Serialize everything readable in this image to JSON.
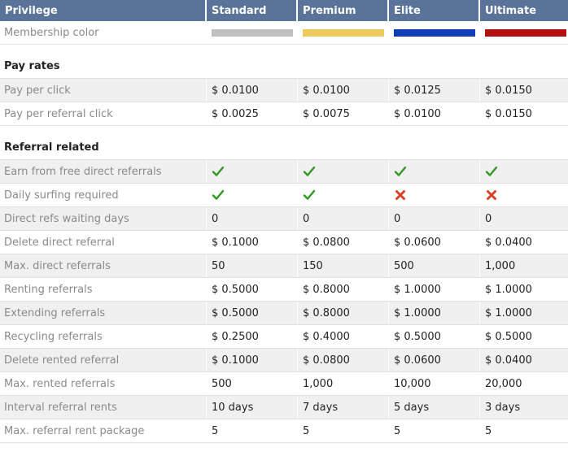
{
  "header": {
    "privilege": "Privilege",
    "plans": [
      "Standard",
      "Premium",
      "Elite",
      "Ultimate"
    ]
  },
  "membership": {
    "label": "Membership color",
    "colors": [
      "#c0c0c0",
      "#eccb5c",
      "#0f3fb5",
      "#b40f0f"
    ]
  },
  "sections": {
    "pay_rates": "Pay rates",
    "referral_related": "Referral related"
  },
  "pay_rates": [
    {
      "label": "Pay per click",
      "values": [
        "$ 0.0100",
        "$ 0.0100",
        "$ 0.0125",
        "$ 0.0150"
      ]
    },
    {
      "label": "Pay per referral click",
      "values": [
        "$ 0.0025",
        "$ 0.0075",
        "$ 0.0100",
        "$ 0.0150"
      ]
    }
  ],
  "referral": [
    {
      "label": "Earn from free direct referrals",
      "icons": [
        "check-icon",
        "check-icon",
        "check-icon",
        "check-icon"
      ]
    },
    {
      "label": "Daily surfing required",
      "icons": [
        "check-icon",
        "check-icon",
        "cross-icon",
        "cross-icon"
      ]
    },
    {
      "label": "Direct refs waiting days",
      "values": [
        "0",
        "0",
        "0",
        "0"
      ]
    },
    {
      "label": "Delete direct referral",
      "values": [
        "$ 0.1000",
        "$ 0.0800",
        "$ 0.0600",
        "$ 0.0400"
      ]
    },
    {
      "label": "Max. direct referrals",
      "values": [
        "50",
        "150",
        "500",
        "1,000"
      ]
    },
    {
      "label": "Renting referrals",
      "values": [
        "$ 0.5000",
        "$ 0.8000",
        "$ 1.0000",
        "$ 1.0000"
      ]
    },
    {
      "label": "Extending referrals",
      "values": [
        "$ 0.5000",
        "$ 0.8000",
        "$ 1.0000",
        "$ 1.0000"
      ]
    },
    {
      "label": "Recycling referrals",
      "values": [
        "$ 0.2500",
        "$ 0.4000",
        "$ 0.5000",
        "$ 0.5000"
      ]
    },
    {
      "label": "Delete rented referral",
      "values": [
        "$ 0.1000",
        "$ 0.0800",
        "$ 0.0600",
        "$ 0.0400"
      ]
    },
    {
      "label": "Max. rented referrals",
      "values": [
        "500",
        "1,000",
        "10,000",
        "20,000"
      ]
    },
    {
      "label": "Interval referral rents",
      "values": [
        "10 days",
        "7 days",
        "5 days",
        "3 days"
      ]
    },
    {
      "label": "Max. referral rent package",
      "values": [
        "5",
        "5",
        "5",
        "5"
      ]
    }
  ],
  "icon_colors": {
    "check": "#2e9a1e",
    "cross": "#d9412a"
  }
}
